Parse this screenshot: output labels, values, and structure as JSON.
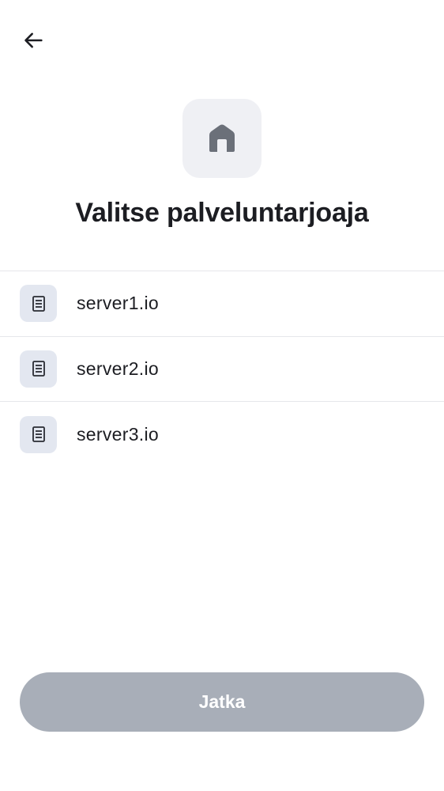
{
  "header": {
    "back_icon": "arrow-left-icon",
    "hero_icon": "home-icon"
  },
  "title": "Valitse palveluntarjoaja",
  "providers": [
    {
      "label": "server1.io",
      "icon": "server-icon"
    },
    {
      "label": "server2.io",
      "icon": "server-icon"
    },
    {
      "label": "server3.io",
      "icon": "server-icon"
    }
  ],
  "footer": {
    "continue_label": "Jatka",
    "continue_disabled": true
  },
  "colors": {
    "text": "#1c1d22",
    "hero_bg": "#eff0f4",
    "item_icon_bg": "#e3e7f0",
    "divider": "#e6e7eb",
    "button_disabled": "#a8aeb8"
  }
}
